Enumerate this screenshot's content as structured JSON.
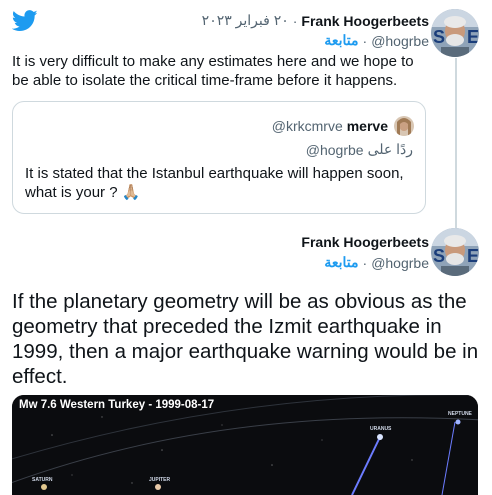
{
  "colors": {
    "accent": "#1d9bf0",
    "text": "#0f1419",
    "muted": "#536471",
    "border": "#cfd9de"
  },
  "icons": {
    "logo": "twitter-bird-icon",
    "verified": "none"
  },
  "tweet1": {
    "author_name": "Frank Hoogerbeets",
    "date": "٢٠ فبراير ٢٠٢٣",
    "handle": "@hogrbe",
    "follow_label": "متابعة",
    "text": "It is very difficult to make any estimates here and we hope to be able to isolate the critical time-frame before it happens."
  },
  "quote": {
    "author_name": "merve",
    "handle": "@krkcmrve",
    "reply_to_label": "ردًا على",
    "reply_to_handle": "@hogrbe",
    "text": "It is stated that the Istanbul earthquake will happen soon, what is your ? 🙏🏼"
  },
  "tweet2": {
    "author_name": "Frank Hoogerbeets",
    "handle": "@hogrbe",
    "follow_label": "متابعة",
    "text": "If the planetary geometry will be as obvious as the geometry that preceded the Izmit earthquake in 1999, then a major earthquake warning would be in effect."
  },
  "media": {
    "title": "Mw 7.6 Western Turkey - 1999-08-17",
    "labels": {
      "uranus": "URANUS",
      "neptune": "NEPTUNE",
      "saturn": "SATURN",
      "jupiter": "JUPITER"
    }
  }
}
